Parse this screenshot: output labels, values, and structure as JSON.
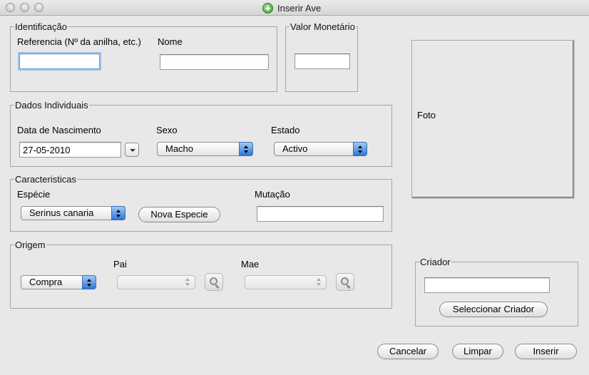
{
  "window": {
    "title": "Inserir Ave",
    "title_icon": "add-icon"
  },
  "identificacao": {
    "legend": "Identificação",
    "referencia_label": "Referencia (Nº da anilha, etc.)",
    "referencia_value": "",
    "nome_label": "Nome",
    "nome_value": ""
  },
  "valor": {
    "legend": "Valor Monetário",
    "value": ""
  },
  "foto": {
    "label": "Foto"
  },
  "dados": {
    "legend": "Dados Individuais",
    "data_label": "Data de Nascimento",
    "data_value": "27-05-2010",
    "sexo_label": "Sexo",
    "sexo_value": "Macho",
    "estado_label": "Estado",
    "estado_value": "Activo"
  },
  "caracteristicas": {
    "legend": "Caracteristicas",
    "especie_label": "Espécie",
    "especie_value": "Serinus canaria",
    "nova_especie_button": "Nova Especie",
    "mutacao_label": "Mutação",
    "mutacao_value": ""
  },
  "origem": {
    "legend": "Origem",
    "origem_value": "Compra",
    "pai_label": "Pai",
    "pai_value": "",
    "mae_label": "Mae",
    "mae_value": ""
  },
  "criador": {
    "legend": "Criador",
    "value": "",
    "select_button": "Seleccionar Criador"
  },
  "actions": {
    "cancel": "Cancelar",
    "clear": "Limpar",
    "insert": "Inserir"
  },
  "colors": {
    "accent": "#2f76d8",
    "focus_ring": "#9fc3ec",
    "window_bg": "#e8e8e8"
  }
}
